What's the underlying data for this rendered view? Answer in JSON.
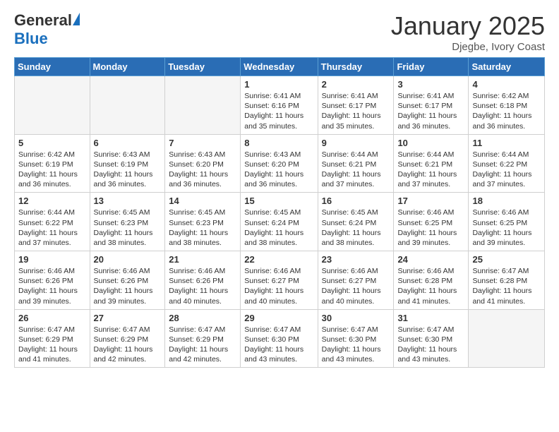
{
  "logo": {
    "general": "General",
    "blue": "Blue",
    "icon": "▲"
  },
  "title": "January 2025",
  "location": "Djegbe, Ivory Coast",
  "weekdays": [
    "Sunday",
    "Monday",
    "Tuesday",
    "Wednesday",
    "Thursday",
    "Friday",
    "Saturday"
  ],
  "weeks": [
    [
      {
        "day": "",
        "info": ""
      },
      {
        "day": "",
        "info": ""
      },
      {
        "day": "",
        "info": ""
      },
      {
        "day": "1",
        "info": "Sunrise: 6:41 AM\nSunset: 6:16 PM\nDaylight: 11 hours\nand 35 minutes."
      },
      {
        "day": "2",
        "info": "Sunrise: 6:41 AM\nSunset: 6:17 PM\nDaylight: 11 hours\nand 35 minutes."
      },
      {
        "day": "3",
        "info": "Sunrise: 6:41 AM\nSunset: 6:17 PM\nDaylight: 11 hours\nand 36 minutes."
      },
      {
        "day": "4",
        "info": "Sunrise: 6:42 AM\nSunset: 6:18 PM\nDaylight: 11 hours\nand 36 minutes."
      }
    ],
    [
      {
        "day": "5",
        "info": "Sunrise: 6:42 AM\nSunset: 6:19 PM\nDaylight: 11 hours\nand 36 minutes."
      },
      {
        "day": "6",
        "info": "Sunrise: 6:43 AM\nSunset: 6:19 PM\nDaylight: 11 hours\nand 36 minutes."
      },
      {
        "day": "7",
        "info": "Sunrise: 6:43 AM\nSunset: 6:20 PM\nDaylight: 11 hours\nand 36 minutes."
      },
      {
        "day": "8",
        "info": "Sunrise: 6:43 AM\nSunset: 6:20 PM\nDaylight: 11 hours\nand 36 minutes."
      },
      {
        "day": "9",
        "info": "Sunrise: 6:44 AM\nSunset: 6:21 PM\nDaylight: 11 hours\nand 37 minutes."
      },
      {
        "day": "10",
        "info": "Sunrise: 6:44 AM\nSunset: 6:21 PM\nDaylight: 11 hours\nand 37 minutes."
      },
      {
        "day": "11",
        "info": "Sunrise: 6:44 AM\nSunset: 6:22 PM\nDaylight: 11 hours\nand 37 minutes."
      }
    ],
    [
      {
        "day": "12",
        "info": "Sunrise: 6:44 AM\nSunset: 6:22 PM\nDaylight: 11 hours\nand 37 minutes."
      },
      {
        "day": "13",
        "info": "Sunrise: 6:45 AM\nSunset: 6:23 PM\nDaylight: 11 hours\nand 38 minutes."
      },
      {
        "day": "14",
        "info": "Sunrise: 6:45 AM\nSunset: 6:23 PM\nDaylight: 11 hours\nand 38 minutes."
      },
      {
        "day": "15",
        "info": "Sunrise: 6:45 AM\nSunset: 6:24 PM\nDaylight: 11 hours\nand 38 minutes."
      },
      {
        "day": "16",
        "info": "Sunrise: 6:45 AM\nSunset: 6:24 PM\nDaylight: 11 hours\nand 38 minutes."
      },
      {
        "day": "17",
        "info": "Sunrise: 6:46 AM\nSunset: 6:25 PM\nDaylight: 11 hours\nand 39 minutes."
      },
      {
        "day": "18",
        "info": "Sunrise: 6:46 AM\nSunset: 6:25 PM\nDaylight: 11 hours\nand 39 minutes."
      }
    ],
    [
      {
        "day": "19",
        "info": "Sunrise: 6:46 AM\nSunset: 6:26 PM\nDaylight: 11 hours\nand 39 minutes."
      },
      {
        "day": "20",
        "info": "Sunrise: 6:46 AM\nSunset: 6:26 PM\nDaylight: 11 hours\nand 39 minutes."
      },
      {
        "day": "21",
        "info": "Sunrise: 6:46 AM\nSunset: 6:26 PM\nDaylight: 11 hours\nand 40 minutes."
      },
      {
        "day": "22",
        "info": "Sunrise: 6:46 AM\nSunset: 6:27 PM\nDaylight: 11 hours\nand 40 minutes."
      },
      {
        "day": "23",
        "info": "Sunrise: 6:46 AM\nSunset: 6:27 PM\nDaylight: 11 hours\nand 40 minutes."
      },
      {
        "day": "24",
        "info": "Sunrise: 6:46 AM\nSunset: 6:28 PM\nDaylight: 11 hours\nand 41 minutes."
      },
      {
        "day": "25",
        "info": "Sunrise: 6:47 AM\nSunset: 6:28 PM\nDaylight: 11 hours\nand 41 minutes."
      }
    ],
    [
      {
        "day": "26",
        "info": "Sunrise: 6:47 AM\nSunset: 6:29 PM\nDaylight: 11 hours\nand 41 minutes."
      },
      {
        "day": "27",
        "info": "Sunrise: 6:47 AM\nSunset: 6:29 PM\nDaylight: 11 hours\nand 42 minutes."
      },
      {
        "day": "28",
        "info": "Sunrise: 6:47 AM\nSunset: 6:29 PM\nDaylight: 11 hours\nand 42 minutes."
      },
      {
        "day": "29",
        "info": "Sunrise: 6:47 AM\nSunset: 6:30 PM\nDaylight: 11 hours\nand 43 minutes."
      },
      {
        "day": "30",
        "info": "Sunrise: 6:47 AM\nSunset: 6:30 PM\nDaylight: 11 hours\nand 43 minutes."
      },
      {
        "day": "31",
        "info": "Sunrise: 6:47 AM\nSunset: 6:30 PM\nDaylight: 11 hours\nand 43 minutes."
      },
      {
        "day": "",
        "info": ""
      }
    ]
  ]
}
